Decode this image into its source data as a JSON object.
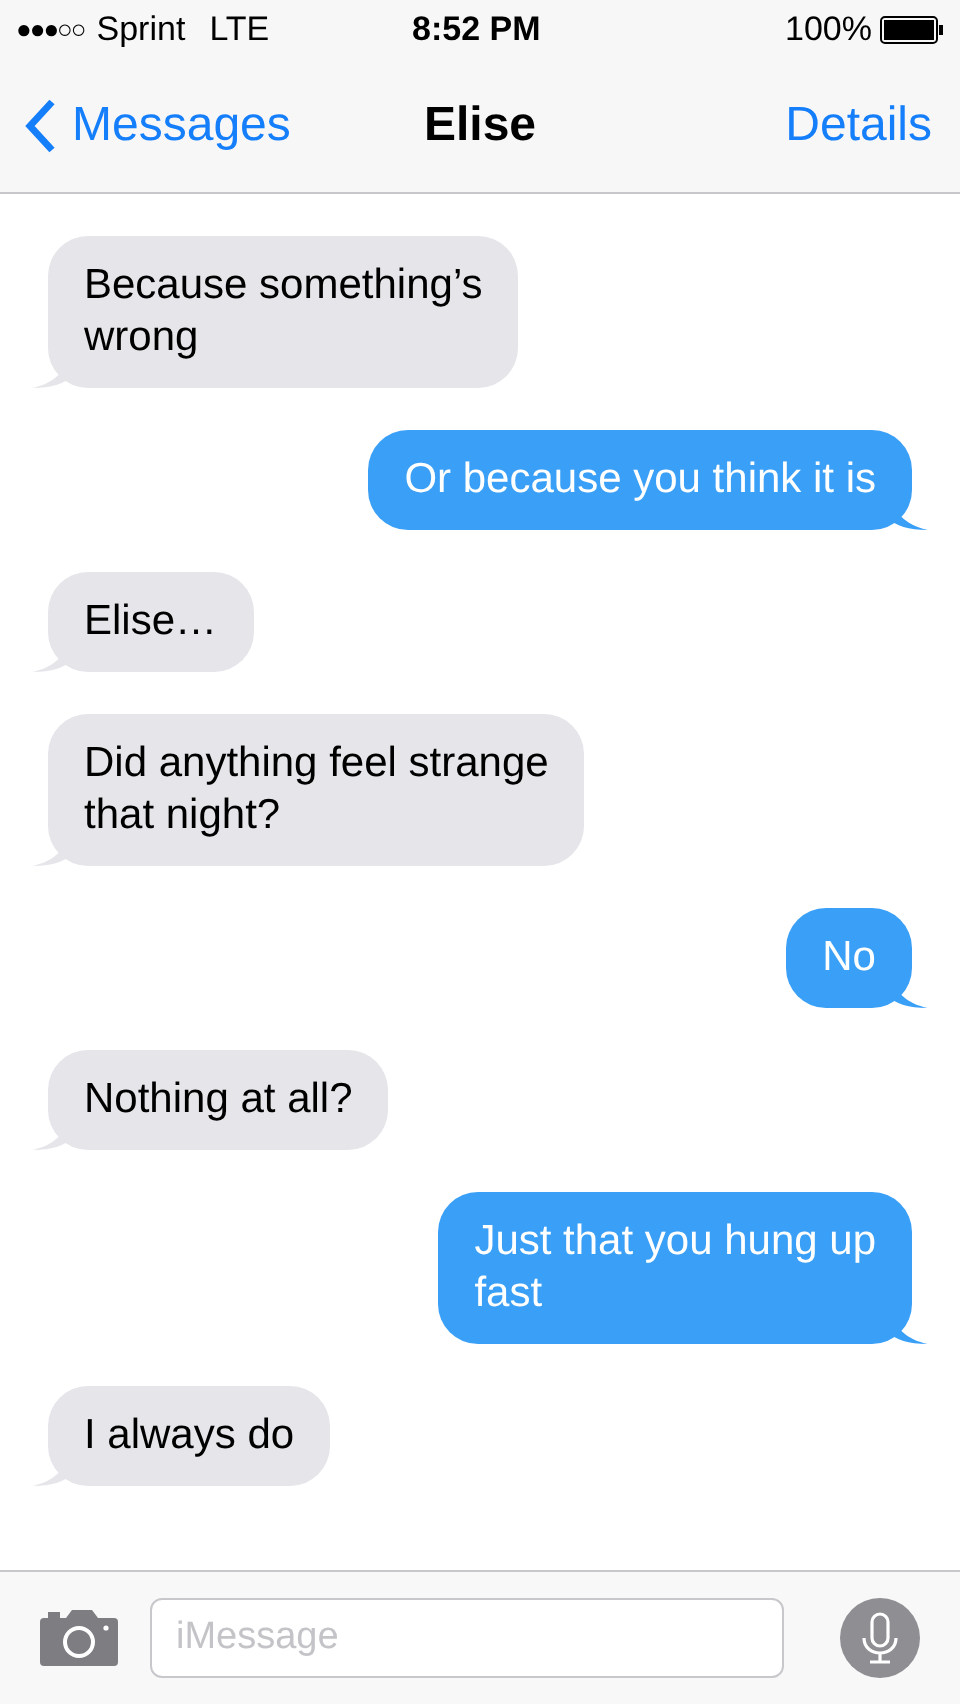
{
  "status_bar": {
    "signal": "●●●○○",
    "carrier": "Sprint",
    "network": "LTE",
    "time": "8:52 PM",
    "battery": "100%"
  },
  "nav": {
    "back": "Messages",
    "title": "Elise",
    "action": "Details"
  },
  "messages": [
    {
      "kind": "received",
      "lines": [
        "Because something’s",
        "wrong"
      ]
    },
    {
      "kind": "sent",
      "lines": [
        "Or because you think it is"
      ]
    },
    {
      "kind": "received",
      "lines": [
        "Elise…"
      ]
    },
    {
      "kind": "received",
      "lines": [
        "Did anything feel strange",
        "that night?"
      ]
    },
    {
      "kind": "sent",
      "lines": [
        "No"
      ]
    },
    {
      "kind": "received",
      "lines": [
        "Nothing at all?"
      ]
    },
    {
      "kind": "sent",
      "lines": [
        "Just that you hung up",
        "fast"
      ]
    },
    {
      "kind": "received",
      "lines": [
        "I always do"
      ]
    }
  ],
  "input": {
    "placeholder": "iMessage"
  }
}
